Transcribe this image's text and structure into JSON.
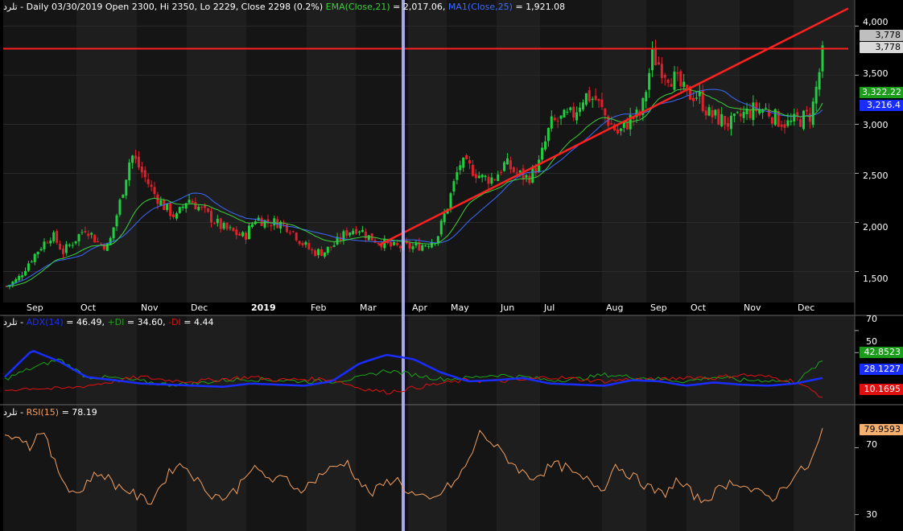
{
  "price_panel": {
    "title": {
      "symbol": "تلرد",
      "info": " - Daily 03/30/2019 Open 2300, Hi 2350, Lo 2229, Close 2298 (0.2%)",
      "ema_label": "EMA(Close,21)",
      "ema_value": " = 2,017.06,",
      "ma_label": "MA1(Close,25)",
      "ma_value": " = 1,921.08"
    },
    "badges": {
      "high": "3,778",
      "last": "3,778",
      "ema": "3,322.22",
      "ma": "3,216.4"
    },
    "y_ticks": [
      "4,000",
      "3,500",
      "3,000",
      "2,500",
      "2,000",
      "1,500"
    ],
    "x_labels": [
      "Sep",
      "Oct",
      "Nov",
      "Dec",
      "2019",
      "Feb",
      "Mar",
      "Apr",
      "May",
      "Jun",
      "Jul",
      "Aug",
      "Sep",
      "Oct",
      "Nov",
      "Dec"
    ]
  },
  "adx_panel": {
    "title": {
      "symbol": "تلرد",
      "adx_label": "ADX(14)",
      "adx_value": " = 46.49,",
      "pdi_label": "+DI",
      "pdi_value": " = 34.60,",
      "mdi_label": "-DI",
      "mdi_value": " = 4.44"
    },
    "y_ticks": [
      "70",
      "50"
    ],
    "badges": {
      "pdi": "42.8523",
      "adx": "28.1227",
      "mdi": "10.1695"
    }
  },
  "rsi_panel": {
    "title": {
      "symbol": "تلرد",
      "rsi_label": "RSI(15)",
      "rsi_value": " = 78.19"
    },
    "y_ticks": [
      "70",
      "30"
    ],
    "badge": "79.9593"
  },
  "colors": {
    "up": "#1fcf3f",
    "down": "#e0202a",
    "ema": "#3bd13b",
    "ma": "#3a6bff",
    "trend": "#ff2020",
    "cursor": "#b8b8ff",
    "adx": "#1a2dff",
    "pdi": "#1aa31a",
    "mdi": "#e01010",
    "rsi": "#f5a060"
  },
  "chart_data": [
    {
      "type": "candlestick",
      "title": "تلرد - Daily",
      "x_labels": [
        "Sep",
        "Oct",
        "Nov",
        "Dec",
        "2019",
        "Feb",
        "Mar",
        "Apr",
        "May",
        "Jun",
        "Jul",
        "Aug",
        "Sep",
        "Oct",
        "Nov",
        "Dec"
      ],
      "ylim": [
        1250,
        4200
      ],
      "y_ticks": [
        1500,
        2000,
        2500,
        3000,
        3500,
        4000
      ],
      "ohlc_path_close": [
        1350,
        1420,
        1600,
        1750,
        1880,
        1700,
        1820,
        1950,
        1800,
        1750,
        2200,
        2700,
        2500,
        2300,
        2150,
        2050,
        2250,
        2150,
        2050,
        1950,
        1900,
        1850,
        2050,
        2000,
        2000,
        1950,
        1800,
        1700,
        1700,
        1780,
        1900,
        1950,
        1850,
        1800,
        1750,
        1750,
        1750,
        1780,
        1850,
        2200,
        2600,
        2550,
        2450,
        2450,
        2600,
        2500,
        2450,
        2600,
        3000,
        3050,
        3100,
        3300,
        3250,
        3050,
        2900,
        3050,
        3100,
        3700,
        3550,
        3450,
        3300,
        3300,
        3100,
        3050,
        3000,
        3100,
        3150,
        3150,
        3050,
        3000,
        3050,
        3100,
        3700
      ],
      "series": [
        {
          "name": "EMA(Close,21)",
          "last": 3322.22
        },
        {
          "name": "MA1(Close,25)",
          "last": 3216.4
        }
      ],
      "horizontal_line": 3778,
      "trendline": {
        "from_value": 1770,
        "from": "Mar",
        "to_value": 4180,
        "to": "Dec"
      }
    },
    {
      "type": "line",
      "title": "ADX(14)",
      "y_ticks": [
        50,
        70
      ],
      "series": [
        {
          "name": "ADX(14)",
          "values": [
            28,
            52,
            42,
            28,
            25,
            22,
            21,
            20,
            19,
            22,
            21,
            20,
            24,
            40,
            48,
            44,
            32,
            24,
            25,
            27,
            22,
            21,
            20,
            25,
            24,
            20,
            23,
            21,
            20,
            22,
            27
          ]
        },
        {
          "name": "+DI",
          "values": [
            26,
            36,
            44,
            28,
            27,
            24,
            21,
            22,
            25,
            26,
            25,
            24,
            24,
            27,
            34,
            30,
            26,
            27,
            30,
            28,
            25,
            26,
            30,
            28,
            26,
            24,
            28,
            25,
            25,
            23,
            42
          ]
        },
        {
          "name": "-DI",
          "values": [
            16,
            18,
            17,
            20,
            24,
            28,
            25,
            24,
            26,
            28,
            25,
            26,
            26,
            18,
            14,
            18,
            22,
            25,
            24,
            25,
            28,
            26,
            24,
            26,
            25,
            28,
            27,
            30,
            28,
            24,
            10
          ]
        }
      ]
    },
    {
      "type": "line",
      "title": "RSI(15)",
      "y_ticks": [
        30,
        70
      ],
      "series": [
        {
          "name": "RSI(15)",
          "values": [
            75,
            80,
            70,
            82,
            62,
            48,
            42,
            52,
            55,
            48,
            45,
            40,
            38,
            50,
            60,
            58,
            48,
            42,
            40,
            45,
            58,
            55,
            50,
            52,
            45,
            48,
            55,
            58,
            62,
            50,
            42,
            48,
            52,
            44,
            40,
            38,
            45,
            50,
            62,
            80,
            72,
            65,
            58,
            52,
            55,
            60,
            58,
            52,
            50,
            45,
            60,
            55,
            50,
            45,
            42,
            50,
            45,
            38,
            42,
            48,
            50,
            45,
            42,
            40,
            48,
            55,
            60,
            80
          ]
        }
      ]
    }
  ]
}
